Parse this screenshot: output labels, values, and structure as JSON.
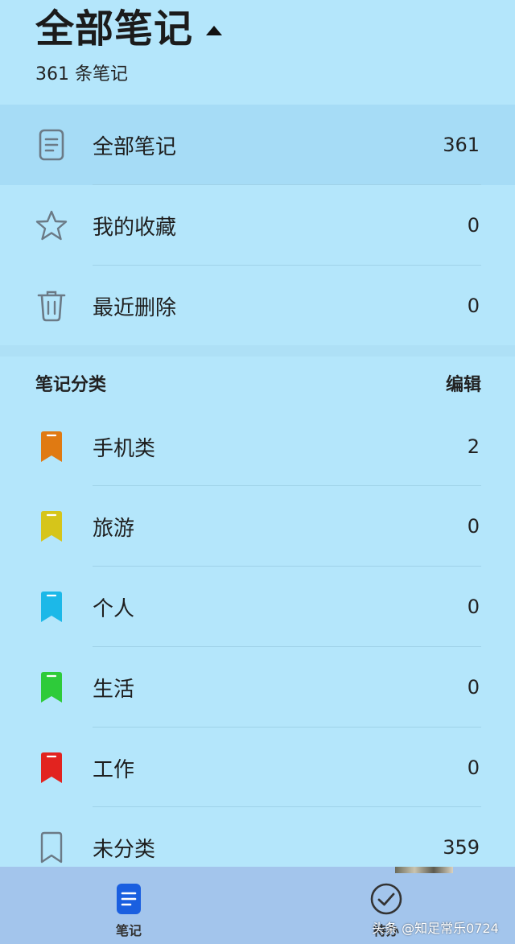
{
  "header": {
    "title": "全部笔记",
    "subtitle": "361 条笔记"
  },
  "system_folders": [
    {
      "label": "全部笔记",
      "count": "361",
      "icon": "note-icon",
      "selected": true
    },
    {
      "label": "我的收藏",
      "count": "0",
      "icon": "star-icon"
    },
    {
      "label": "最近删除",
      "count": "0",
      "icon": "trash-icon"
    }
  ],
  "categories_section": {
    "title": "笔记分类",
    "edit_label": "编辑"
  },
  "categories": [
    {
      "label": "手机类",
      "count": "2",
      "color": "#e07a12"
    },
    {
      "label": "旅游",
      "count": "0",
      "color": "#d6c51a"
    },
    {
      "label": "个人",
      "count": "0",
      "color": "#1cb8e8"
    },
    {
      "label": "生活",
      "count": "0",
      "color": "#2ecb3a"
    },
    {
      "label": "工作",
      "count": "0",
      "color": "#e2231f"
    },
    {
      "label": "未分类",
      "count": "359",
      "color": "outline"
    }
  ],
  "tabbar": {
    "notes_label": "笔记",
    "todo_label": "待办",
    "accent": "#1a5fe0"
  },
  "watermark": "头条 @知足常乐0724"
}
